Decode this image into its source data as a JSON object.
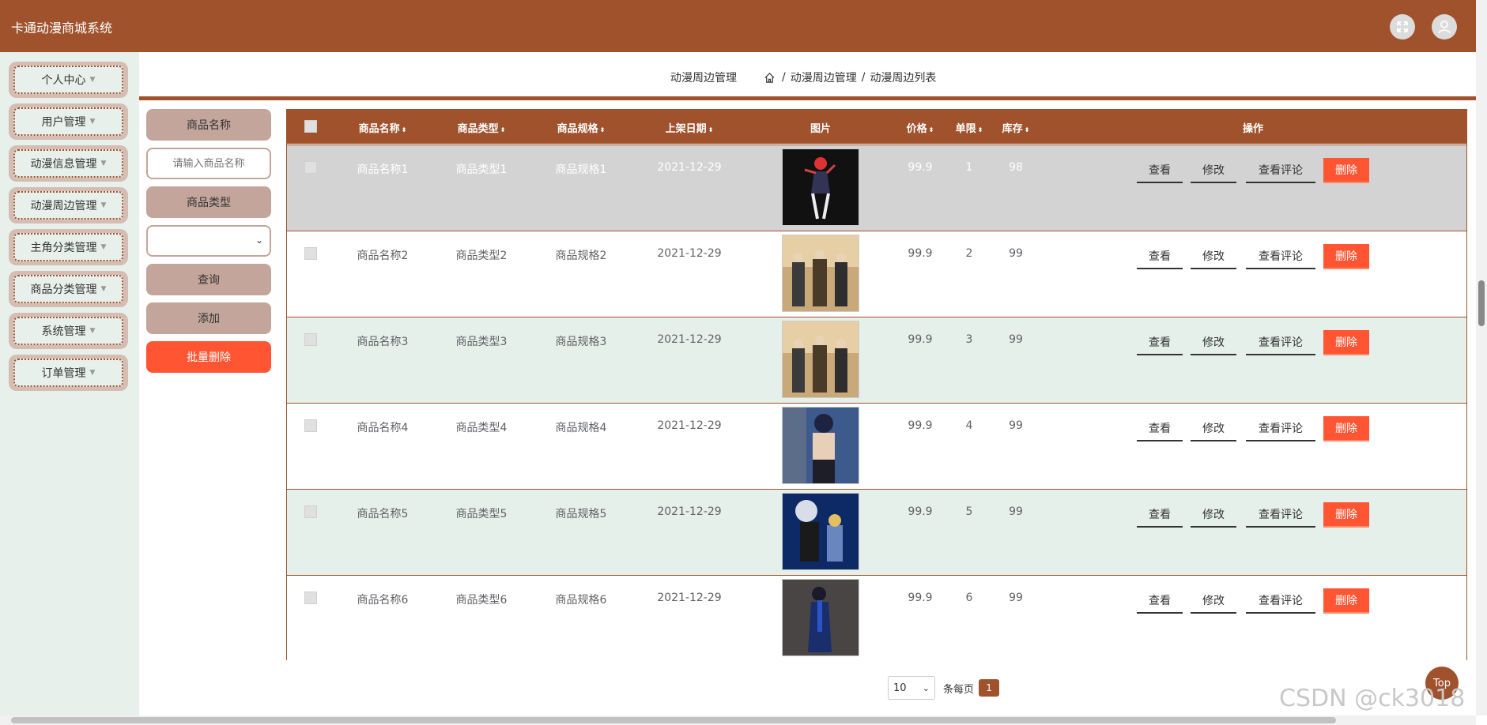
{
  "app": {
    "title": "卡通动漫商城系统"
  },
  "header": {
    "fullscreen_icon": "fullscreen-icon",
    "user_icon": "user-icon"
  },
  "sidebar": {
    "items": [
      {
        "label": "个人中心"
      },
      {
        "label": "用户管理"
      },
      {
        "label": "动漫信息管理"
      },
      {
        "label": "动漫周边管理"
      },
      {
        "label": "主角分类管理"
      },
      {
        "label": "商品分类管理"
      },
      {
        "label": "系统管理"
      },
      {
        "label": "订单管理"
      }
    ]
  },
  "breadcrumb": {
    "title": "动漫周边管理",
    "home_icon": "home-icon",
    "path": [
      "动漫周边管理",
      "动漫周边列表"
    ],
    "separator": "/"
  },
  "filters": {
    "name_label": "商品名称",
    "name_placeholder": "请输入商品名称",
    "type_label": "商品类型",
    "type_value": "",
    "search_button": "查询",
    "add_button": "添加",
    "batch_delete_button": "批量删除"
  },
  "table": {
    "columns": [
      "商品名称",
      "商品类型",
      "商品规格",
      "上架日期",
      "图片",
      "价格",
      "单限",
      "库存",
      "操作"
    ],
    "actions": {
      "view": "查看",
      "edit": "修改",
      "comments": "查看评论",
      "delete": "删除"
    },
    "rows": [
      {
        "name": "商品名称1",
        "type": "商品类型1",
        "spec": "商品规格1",
        "date": "2021-12-29",
        "price": "99.9",
        "limit": "1",
        "stock": "98"
      },
      {
        "name": "商品名称2",
        "type": "商品类型2",
        "spec": "商品规格2",
        "date": "2021-12-29",
        "price": "99.9",
        "limit": "2",
        "stock": "99"
      },
      {
        "name": "商品名称3",
        "type": "商品类型3",
        "spec": "商品规格3",
        "date": "2021-12-29",
        "price": "99.9",
        "limit": "3",
        "stock": "99"
      },
      {
        "name": "商品名称4",
        "type": "商品类型4",
        "spec": "商品规格4",
        "date": "2021-12-29",
        "price": "99.9",
        "limit": "4",
        "stock": "99"
      },
      {
        "name": "商品名称5",
        "type": "商品类型5",
        "spec": "商品规格5",
        "date": "2021-12-29",
        "price": "99.9",
        "limit": "5",
        "stock": "99"
      },
      {
        "name": "商品名称6",
        "type": "商品类型6",
        "spec": "商品规格6",
        "date": "2021-12-29",
        "price": "99.9",
        "limit": "6",
        "stock": "99"
      }
    ]
  },
  "pagination": {
    "page_size": "10",
    "per_page_text": "条每页",
    "current_page": "1"
  },
  "top_button": "Top",
  "watermark": "CSDN @ck3018",
  "colors": {
    "brand": "#a0522d",
    "danger": "#ff5533",
    "sidebar_bg": "#e7f0eb",
    "label_bg": "#c3a59b"
  }
}
